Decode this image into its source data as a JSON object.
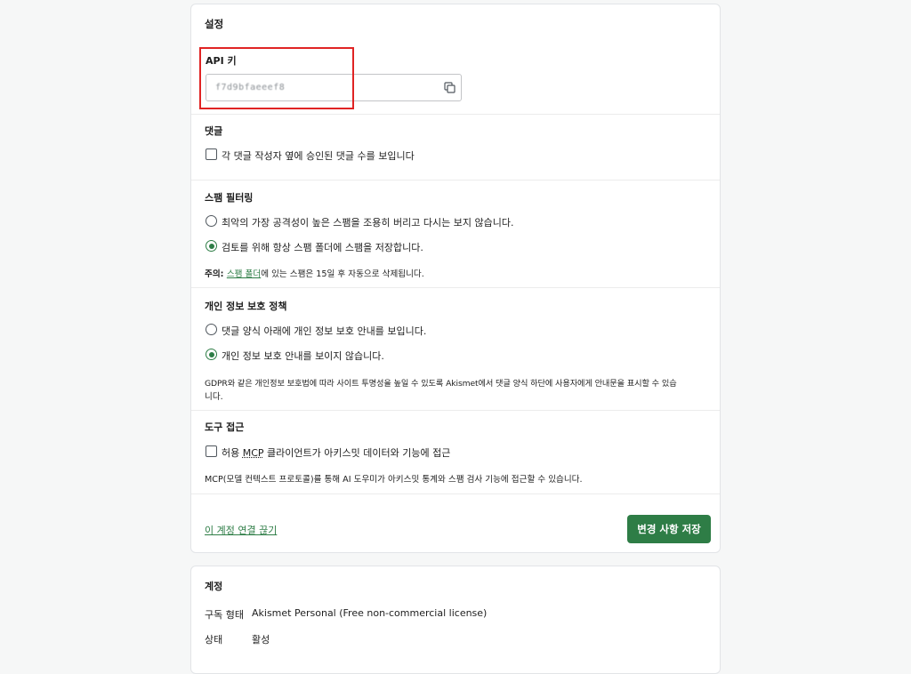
{
  "settings": {
    "title": "설정",
    "api_key": {
      "label": "API 키",
      "value": "f7d9bfaeeef8",
      "copy_icon": "copy-icon"
    },
    "comments": {
      "title": "댓글",
      "option": "각 댓글 작성자 옆에 승인된 댓글 수를 보입니다",
      "checked": false
    },
    "spam": {
      "title": "스팸 필터링",
      "options": [
        {
          "label": "최악의 가장 공격성이 높은 스팸을 조용히 버리고 다시는 보지 않습니다.",
          "selected": false
        },
        {
          "label": "검토를 위해 항상 스팸 폴더에 스팸을 저장합니다.",
          "selected": true
        }
      ],
      "note_prefix": "주의: ",
      "note_link": "스팸 폴더",
      "note_suffix": "에 있는 스팸은 15일 후 자동으로 삭제됩니다."
    },
    "privacy": {
      "title": "개인 정보 보호 정책",
      "options": [
        {
          "label": "댓글 양식 아래에 개인 정보 보호 안내를 보입니다.",
          "selected": false
        },
        {
          "label": "개인 정보 보호 안내를 보이지 않습니다.",
          "selected": true
        }
      ],
      "note_line1": "GDPR와 같은 개인정보 보호법에 따라 사이트 투명성을 높일 수 있도록 Akismet에서 댓글 양식 하단에 사용자에게 안내문을 표시할 수 있습",
      "note_line2": "니다."
    },
    "tools": {
      "title": "도구 접근",
      "option_prefix": "허용 ",
      "option_mcp": "MCP",
      "option_suffix": " 클라이언트가 아키스밋 데이터와 기능에 접근",
      "checked": false,
      "note": "MCP(모델 컨텍스트 프로토콜)를 통해 AI 도우미가 아키스밋 통계와 스팸 검사 기능에 접근할 수 있습니다."
    },
    "disconnect_link": "이 계정 연결 끊기",
    "save_button": "변경 사항 저장"
  },
  "account": {
    "title": "계정",
    "rows": [
      {
        "key": "구독 형태",
        "value": "Akismet Personal (Free non-commercial license)"
      },
      {
        "key": "상태",
        "value": "활성"
      }
    ]
  },
  "colors": {
    "accent": "#2e7d46",
    "highlight": "#e02424"
  }
}
